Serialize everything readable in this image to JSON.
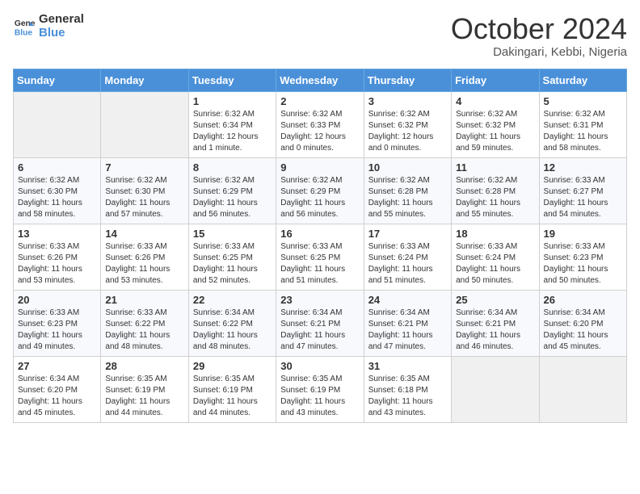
{
  "header": {
    "logo_line1": "General",
    "logo_line2": "Blue",
    "month": "October 2024",
    "location": "Dakingari, Kebbi, Nigeria"
  },
  "days_of_week": [
    "Sunday",
    "Monday",
    "Tuesday",
    "Wednesday",
    "Thursday",
    "Friday",
    "Saturday"
  ],
  "weeks": [
    [
      {
        "day": "",
        "empty": true
      },
      {
        "day": "",
        "empty": true
      },
      {
        "day": "1",
        "sunrise": "6:32 AM",
        "sunset": "6:34 PM",
        "daylight": "12 hours and 1 minute."
      },
      {
        "day": "2",
        "sunrise": "6:32 AM",
        "sunset": "6:33 PM",
        "daylight": "12 hours and 0 minutes."
      },
      {
        "day": "3",
        "sunrise": "6:32 AM",
        "sunset": "6:32 PM",
        "daylight": "12 hours and 0 minutes."
      },
      {
        "day": "4",
        "sunrise": "6:32 AM",
        "sunset": "6:32 PM",
        "daylight": "11 hours and 59 minutes."
      },
      {
        "day": "5",
        "sunrise": "6:32 AM",
        "sunset": "6:31 PM",
        "daylight": "11 hours and 58 minutes."
      }
    ],
    [
      {
        "day": "6",
        "sunrise": "6:32 AM",
        "sunset": "6:30 PM",
        "daylight": "11 hours and 58 minutes."
      },
      {
        "day": "7",
        "sunrise": "6:32 AM",
        "sunset": "6:30 PM",
        "daylight": "11 hours and 57 minutes."
      },
      {
        "day": "8",
        "sunrise": "6:32 AM",
        "sunset": "6:29 PM",
        "daylight": "11 hours and 56 minutes."
      },
      {
        "day": "9",
        "sunrise": "6:32 AM",
        "sunset": "6:29 PM",
        "daylight": "11 hours and 56 minutes."
      },
      {
        "day": "10",
        "sunrise": "6:32 AM",
        "sunset": "6:28 PM",
        "daylight": "11 hours and 55 minutes."
      },
      {
        "day": "11",
        "sunrise": "6:32 AM",
        "sunset": "6:28 PM",
        "daylight": "11 hours and 55 minutes."
      },
      {
        "day": "12",
        "sunrise": "6:33 AM",
        "sunset": "6:27 PM",
        "daylight": "11 hours and 54 minutes."
      }
    ],
    [
      {
        "day": "13",
        "sunrise": "6:33 AM",
        "sunset": "6:26 PM",
        "daylight": "11 hours and 53 minutes."
      },
      {
        "day": "14",
        "sunrise": "6:33 AM",
        "sunset": "6:26 PM",
        "daylight": "11 hours and 53 minutes."
      },
      {
        "day": "15",
        "sunrise": "6:33 AM",
        "sunset": "6:25 PM",
        "daylight": "11 hours and 52 minutes."
      },
      {
        "day": "16",
        "sunrise": "6:33 AM",
        "sunset": "6:25 PM",
        "daylight": "11 hours and 51 minutes."
      },
      {
        "day": "17",
        "sunrise": "6:33 AM",
        "sunset": "6:24 PM",
        "daylight": "11 hours and 51 minutes."
      },
      {
        "day": "18",
        "sunrise": "6:33 AM",
        "sunset": "6:24 PM",
        "daylight": "11 hours and 50 minutes."
      },
      {
        "day": "19",
        "sunrise": "6:33 AM",
        "sunset": "6:23 PM",
        "daylight": "11 hours and 50 minutes."
      }
    ],
    [
      {
        "day": "20",
        "sunrise": "6:33 AM",
        "sunset": "6:23 PM",
        "daylight": "11 hours and 49 minutes."
      },
      {
        "day": "21",
        "sunrise": "6:33 AM",
        "sunset": "6:22 PM",
        "daylight": "11 hours and 48 minutes."
      },
      {
        "day": "22",
        "sunrise": "6:34 AM",
        "sunset": "6:22 PM",
        "daylight": "11 hours and 48 minutes."
      },
      {
        "day": "23",
        "sunrise": "6:34 AM",
        "sunset": "6:21 PM",
        "daylight": "11 hours and 47 minutes."
      },
      {
        "day": "24",
        "sunrise": "6:34 AM",
        "sunset": "6:21 PM",
        "daylight": "11 hours and 47 minutes."
      },
      {
        "day": "25",
        "sunrise": "6:34 AM",
        "sunset": "6:21 PM",
        "daylight": "11 hours and 46 minutes."
      },
      {
        "day": "26",
        "sunrise": "6:34 AM",
        "sunset": "6:20 PM",
        "daylight": "11 hours and 45 minutes."
      }
    ],
    [
      {
        "day": "27",
        "sunrise": "6:34 AM",
        "sunset": "6:20 PM",
        "daylight": "11 hours and 45 minutes."
      },
      {
        "day": "28",
        "sunrise": "6:35 AM",
        "sunset": "6:19 PM",
        "daylight": "11 hours and 44 minutes."
      },
      {
        "day": "29",
        "sunrise": "6:35 AM",
        "sunset": "6:19 PM",
        "daylight": "11 hours and 44 minutes."
      },
      {
        "day": "30",
        "sunrise": "6:35 AM",
        "sunset": "6:19 PM",
        "daylight": "11 hours and 43 minutes."
      },
      {
        "day": "31",
        "sunrise": "6:35 AM",
        "sunset": "6:18 PM",
        "daylight": "11 hours and 43 minutes."
      },
      {
        "day": "",
        "empty": true
      },
      {
        "day": "",
        "empty": true
      }
    ]
  ],
  "labels": {
    "sunrise": "Sunrise:",
    "sunset": "Sunset:",
    "daylight": "Daylight:"
  }
}
